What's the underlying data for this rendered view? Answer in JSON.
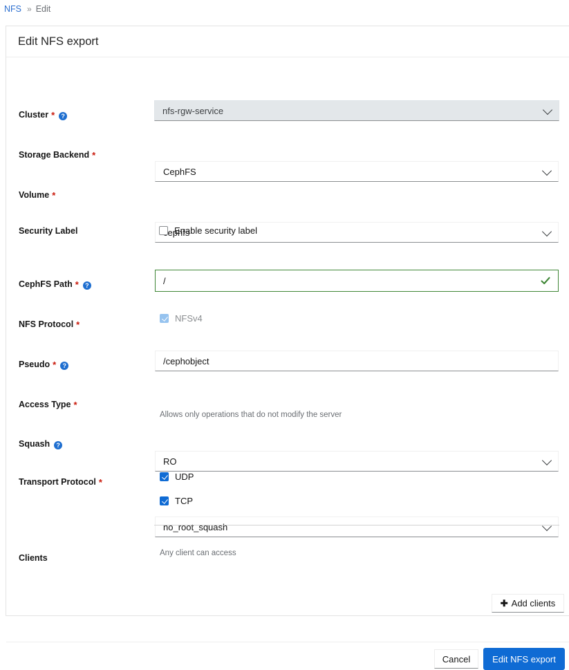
{
  "breadcrumb": {
    "root": "NFS",
    "separator": "»",
    "current": "Edit"
  },
  "card": {
    "title": "Edit NFS export"
  },
  "form": {
    "cluster": {
      "label": "Cluster",
      "required_marker": "*",
      "help_icon": "help-circle-icon",
      "help_glyph": "?",
      "value": "nfs-rgw-service",
      "disabled": true
    },
    "storage_backend": {
      "label": "Storage Backend",
      "required_marker": "*",
      "value": "CephFS"
    },
    "volume": {
      "label": "Volume",
      "required_marker": "*",
      "value": "cephfs"
    },
    "security_label": {
      "label": "Security Label",
      "checkbox_label": "Enable security label",
      "checked": false
    },
    "cephfs_path": {
      "label": "CephFS Path",
      "required_marker": "*",
      "help_glyph": "?",
      "value": "/",
      "valid": true
    },
    "nfs_protocol": {
      "label": "NFS Protocol",
      "required_marker": "*",
      "checkbox_label": "NFSv4",
      "checked": true,
      "disabled": true
    },
    "pseudo": {
      "label": "Pseudo",
      "required_marker": "*",
      "help_glyph": "?",
      "value": "/cephobject"
    },
    "access_type": {
      "label": "Access Type",
      "required_marker": "*",
      "value": "RO",
      "hint": "Allows only operations that do not modify the server"
    },
    "squash": {
      "label": "Squash",
      "help_glyph": "?",
      "value": "no_root_squash"
    },
    "transport_protocol": {
      "label": "Transport Protocol",
      "required_marker": "*",
      "options": [
        {
          "label": "UDP",
          "checked": true
        },
        {
          "label": "TCP",
          "checked": true
        }
      ]
    },
    "clients": {
      "label": "Clients",
      "empty_text": "Any client can access",
      "add_button": "Add clients",
      "add_button_icon": "plus-icon"
    }
  },
  "footer": {
    "cancel": "Cancel",
    "submit": "Edit NFS export"
  },
  "colors": {
    "primary": "#0f6bd4",
    "link": "#2b6ecf",
    "required": "#c9190b",
    "valid": "#3e8635",
    "muted": "#6a6e73"
  }
}
